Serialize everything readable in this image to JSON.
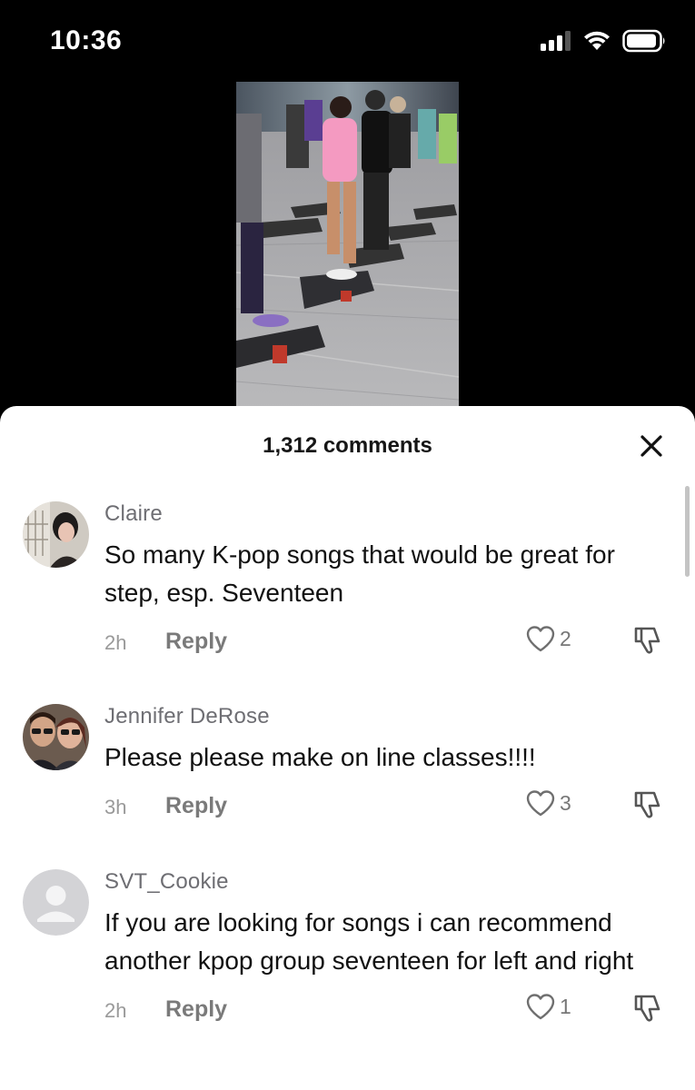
{
  "status_bar": {
    "time": "10:36",
    "icons": [
      "cellular-signal-icon",
      "wifi-icon",
      "battery-icon"
    ]
  },
  "video": {
    "description_icon": "video-thumbnail"
  },
  "comments_sheet": {
    "title": "1,312 comments",
    "close_icon": "close-icon",
    "comments": [
      {
        "username": "Claire",
        "text": "So many K-pop songs that would be great for step, esp. Seventeen",
        "time": "2h",
        "reply_label": "Reply",
        "likes": "2"
      },
      {
        "username": "Jennifer DeRose",
        "text": "Please please make on line classes!!!!",
        "time": "3h",
        "reply_label": "Reply",
        "likes": "3"
      },
      {
        "username": "SVT_Cookie",
        "text": "If you are looking for songs i can recommend another kpop group seventeen for left and right",
        "time": "2h",
        "reply_label": "Reply",
        "likes": "1"
      }
    ]
  },
  "colors": {
    "background": "#000000",
    "sheet": "#ffffff",
    "muted_text": "#777777"
  }
}
